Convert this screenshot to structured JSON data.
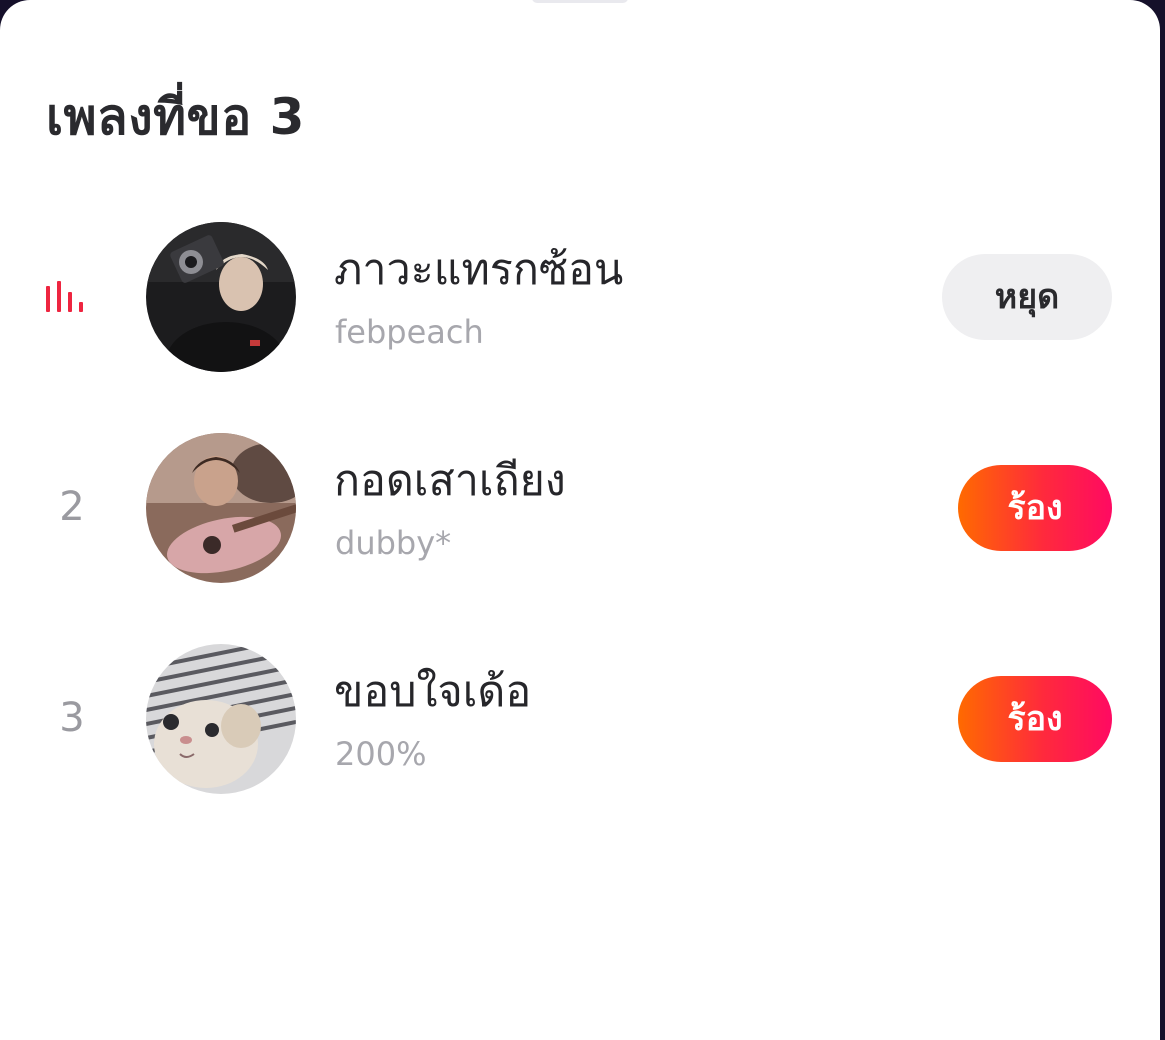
{
  "panel": {
    "title": "เพลงที่ขอ 3"
  },
  "queue": [
    {
      "rank": "",
      "now_playing": true,
      "song": "ภาวะแทรกซ้อน",
      "artist": "febpeach",
      "button_label": "หยุด",
      "button_style": "stop"
    },
    {
      "rank": "2",
      "now_playing": false,
      "song": "กอดเสาเถียง",
      "artist": "dubby*",
      "button_label": "ร้อง",
      "button_style": "sing"
    },
    {
      "rank": "3",
      "now_playing": false,
      "song": "ขอบใจเด้อ",
      "artist": "200%",
      "button_label": "ร้อง",
      "button_style": "sing"
    }
  ],
  "colors": {
    "accent": "#ee2540",
    "sing_gradient_start": "#ff6a00",
    "sing_gradient_end": "#ff0a62",
    "stop_button_bg": "#efeff1"
  },
  "icons": {
    "now_playing": "equalizer-icon"
  }
}
